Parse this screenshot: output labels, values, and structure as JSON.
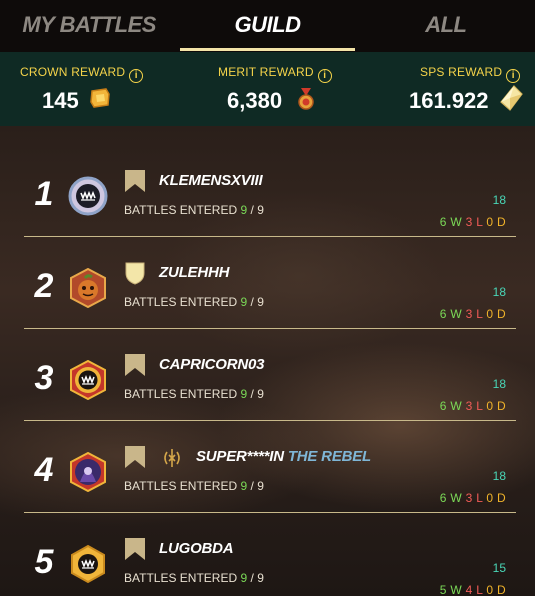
{
  "tabs": [
    {
      "label": "MY BATTLES",
      "active": false
    },
    {
      "label": "GUILD",
      "active": true
    },
    {
      "label": "ALL",
      "active": false
    }
  ],
  "rewards": {
    "crown": {
      "label": "CROWN REWARD",
      "value": "145",
      "icon": "crown-token-icon"
    },
    "merit": {
      "label": "MERIT REWARD",
      "value": "6,380",
      "icon": "merit-medal-icon"
    },
    "sps": {
      "label": "SPS REWARD",
      "value": "161.922",
      "icon": "sps-crystal-icon"
    },
    "info_glyph": "i"
  },
  "battles_label": "BATTLES ENTERED",
  "players": [
    {
      "rank": "1",
      "name": "KLEMENSXVIII",
      "guild": "",
      "entered": "9",
      "total": "9",
      "score": "18",
      "w": "6",
      "l": "3",
      "d": "0",
      "badge": "flag",
      "avatar": "silver-monster-avatar"
    },
    {
      "rank": "2",
      "name": "ZULEHHH",
      "guild": "",
      "entered": "9",
      "total": "9",
      "score": "18",
      "w": "6",
      "l": "3",
      "d": "0",
      "badge": "shield",
      "avatar": "pumpkin-avatar"
    },
    {
      "rank": "3",
      "name": "CAPRICORN03",
      "guild": "",
      "entered": "9",
      "total": "9",
      "score": "18",
      "w": "6",
      "l": "3",
      "d": "0",
      "badge": "flag",
      "avatar": "gold-monster-avatar"
    },
    {
      "rank": "4",
      "name": "SUPER****IN",
      "guild": "THE REBEL",
      "entered": "9",
      "total": "9",
      "score": "18",
      "w": "6",
      "l": "3",
      "d": "0",
      "badge": "flag",
      "avatar": "wizard-avatar"
    },
    {
      "rank": "5",
      "name": "LUGOBDA",
      "guild": "",
      "entered": "9",
      "total": "9",
      "score": "15",
      "w": "5",
      "l": "4",
      "d": "0",
      "badge": "flag",
      "avatar": "gold-monster-avatar"
    }
  ],
  "colors": {
    "win": "#7bd957",
    "loss": "#f15b57",
    "draw": "#f0b32a",
    "score": "#49d6b7",
    "accent": "#f4d34a"
  }
}
